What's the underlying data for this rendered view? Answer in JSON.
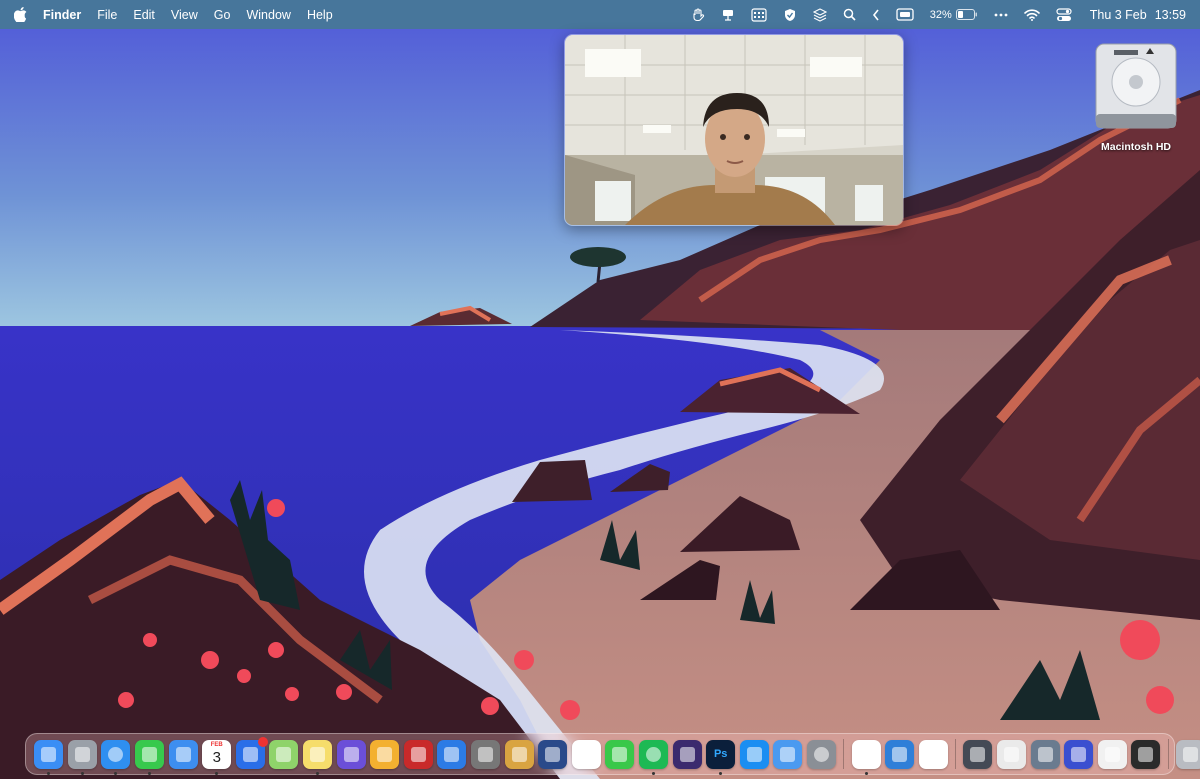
{
  "menubar": {
    "app_name": "Finder",
    "menus": [
      "File",
      "Edit",
      "View",
      "Go",
      "Window",
      "Help"
    ],
    "battery_percent": "32%",
    "date": "Thu 3 Feb",
    "time": "13:59"
  },
  "desktop": {
    "icons": [
      {
        "label": "Macintosh HD",
        "icon": "hard-drive-icon"
      }
    ]
  },
  "camera_window": {
    "content": "webcam-feed"
  },
  "dock": {
    "calendar": {
      "month": "FEB",
      "day": "3"
    },
    "photoshop_label": "Ps",
    "apps": [
      {
        "name": "finder",
        "icon": "finder-icon",
        "color": "#3a8ef5",
        "running": true
      },
      {
        "name": "launchpad",
        "icon": "launchpad-icon",
        "color": "#9aa0a8",
        "running": true
      },
      {
        "name": "safari",
        "icon": "safari-icon",
        "color": "#2f8ff0",
        "running": true
      },
      {
        "name": "messages",
        "icon": "messages-icon",
        "color": "#37c94d",
        "running": true
      },
      {
        "name": "mail",
        "icon": "mail-icon",
        "color": "#3d8ef0",
        "running": false
      },
      {
        "name": "calendar",
        "icon": "calendar-icon",
        "color": "#ffffff",
        "running": true
      },
      {
        "name": "tasks",
        "icon": "tasks-icon",
        "color": "#2a6ee8",
        "running": false
      },
      {
        "name": "maps",
        "icon": "maps-icon",
        "color": "#8fd36a",
        "running": false
      },
      {
        "name": "notes",
        "icon": "notes-icon",
        "color": "#f6dd6b",
        "running": true
      },
      {
        "name": "shortcuts",
        "icon": "shortcuts-icon",
        "color": "#6b4fd8",
        "running": false
      },
      {
        "name": "tes",
        "icon": "butterfly-icon",
        "color": "#f3b030",
        "running": false
      },
      {
        "name": "red-app",
        "icon": "app-icon",
        "color": "#c92a2a",
        "running": false
      },
      {
        "name": "blue-swirl",
        "icon": "swirl-icon",
        "color": "#2c7be5",
        "running": false
      },
      {
        "name": "film",
        "icon": "film-icon",
        "color": "#777777",
        "running": false
      },
      {
        "name": "game",
        "icon": "game-icon",
        "color": "#d9a441",
        "running": false
      },
      {
        "name": "cz",
        "icon": "cz-icon",
        "color": "#2a4a8a",
        "running": false
      },
      {
        "name": "photos",
        "icon": "photos-icon",
        "color": "#ffffff",
        "running": false
      },
      {
        "name": "facetime",
        "icon": "facetime-icon",
        "color": "#39c84a",
        "running": false
      },
      {
        "name": "spotify",
        "icon": "spotify-icon",
        "color": "#1db954",
        "running": true
      },
      {
        "name": "voice",
        "icon": "waveform-icon",
        "color": "#3b2a6e",
        "running": false
      },
      {
        "name": "photoshop",
        "icon": "photoshop-icon",
        "color": "#0b1f3b",
        "running": true
      },
      {
        "name": "app-store",
        "icon": "app-store-icon",
        "color": "#1b8ef2",
        "running": false
      },
      {
        "name": "testflight",
        "icon": "testflight-icon",
        "color": "#4a9af0",
        "running": false
      },
      {
        "name": "system-preferences",
        "icon": "gear-icon",
        "color": "#8a8f96",
        "running": false
      },
      {
        "name": "chrome",
        "icon": "chrome-icon",
        "color": "#ffffff",
        "running": true
      },
      {
        "name": "migration",
        "icon": "migration-icon",
        "color": "#2f7fd8",
        "running": false
      },
      {
        "name": "tuxedo",
        "icon": "tuxedo-icon",
        "color": "#ffffff",
        "running": false
      },
      {
        "name": "box-app",
        "icon": "box-icon",
        "color": "#444a55",
        "running": false
      },
      {
        "name": "preview",
        "icon": "preview-icon",
        "color": "#eaeaea",
        "running": false
      },
      {
        "name": "screenshot",
        "icon": "screenshot-icon",
        "color": "#6a7b8f",
        "running": false
      },
      {
        "name": "video",
        "icon": "video-icon",
        "color": "#3a4fd0",
        "running": false
      },
      {
        "name": "photoshop-doc",
        "icon": "document-icon",
        "color": "#f1f1f1",
        "running": false
      },
      {
        "name": "keyboard",
        "icon": "keyboard-icon",
        "color": "#2b2b2b",
        "running": false
      },
      {
        "name": "trash",
        "icon": "trash-icon",
        "color": "#b9bcc2",
        "running": false
      }
    ]
  },
  "colors": {
    "sky": "#5a62d6",
    "sea": "#3130c6",
    "sand": "#b0827a",
    "rock": "#5a2b32",
    "menubar": "#4678a0"
  }
}
